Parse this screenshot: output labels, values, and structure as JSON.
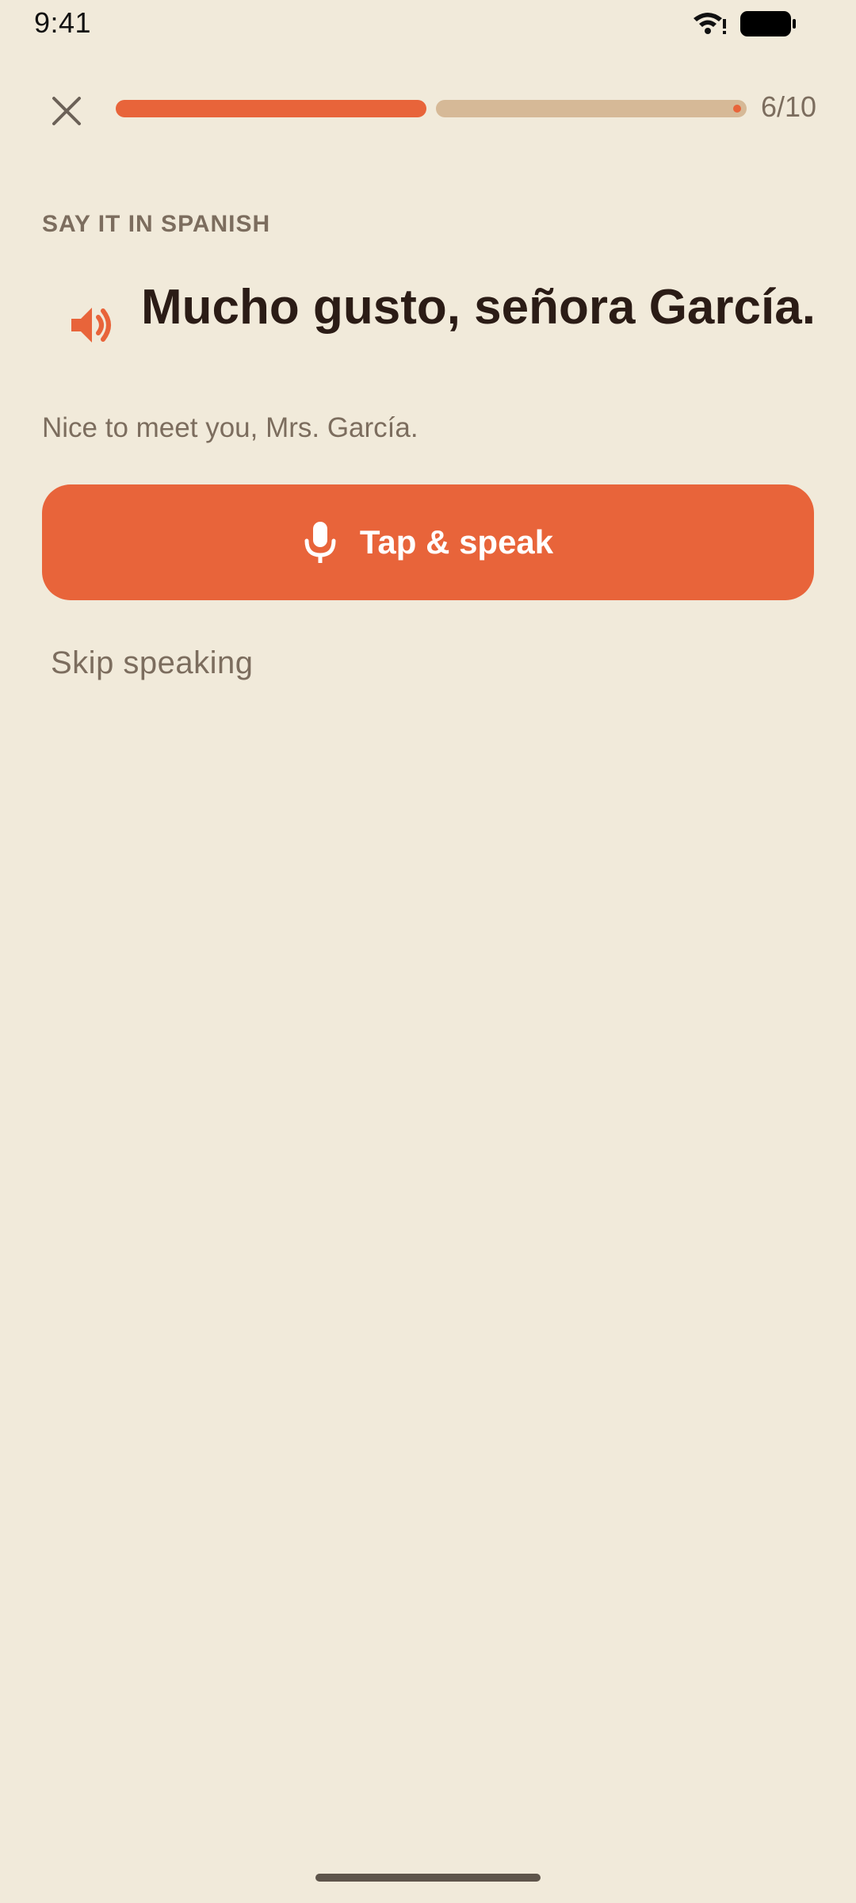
{
  "status_bar": {
    "time": "9:41",
    "wifi_icon": "wifi-icon",
    "battery_icon": "battery-icon"
  },
  "header": {
    "close_icon": "close-icon",
    "progress": {
      "current": 6,
      "total": 10,
      "label": "6/10",
      "fill_fraction": 0.5
    }
  },
  "exercise": {
    "label": "SAY IT IN SPANISH",
    "speaker_icon": "speaker-icon",
    "prompt": "Mucho gusto, señora García.",
    "translation": "Nice to meet you, Mrs. García."
  },
  "actions": {
    "speak_button": {
      "label": "Tap & speak",
      "icon": "microphone-icon"
    },
    "skip_label": "Skip speaking"
  },
  "colors": {
    "background": "#F1EADA",
    "accent": "#E8643A",
    "track": "#D6B997",
    "text_primary": "#2B1C16",
    "text_secondary": "#7C6D5E"
  }
}
